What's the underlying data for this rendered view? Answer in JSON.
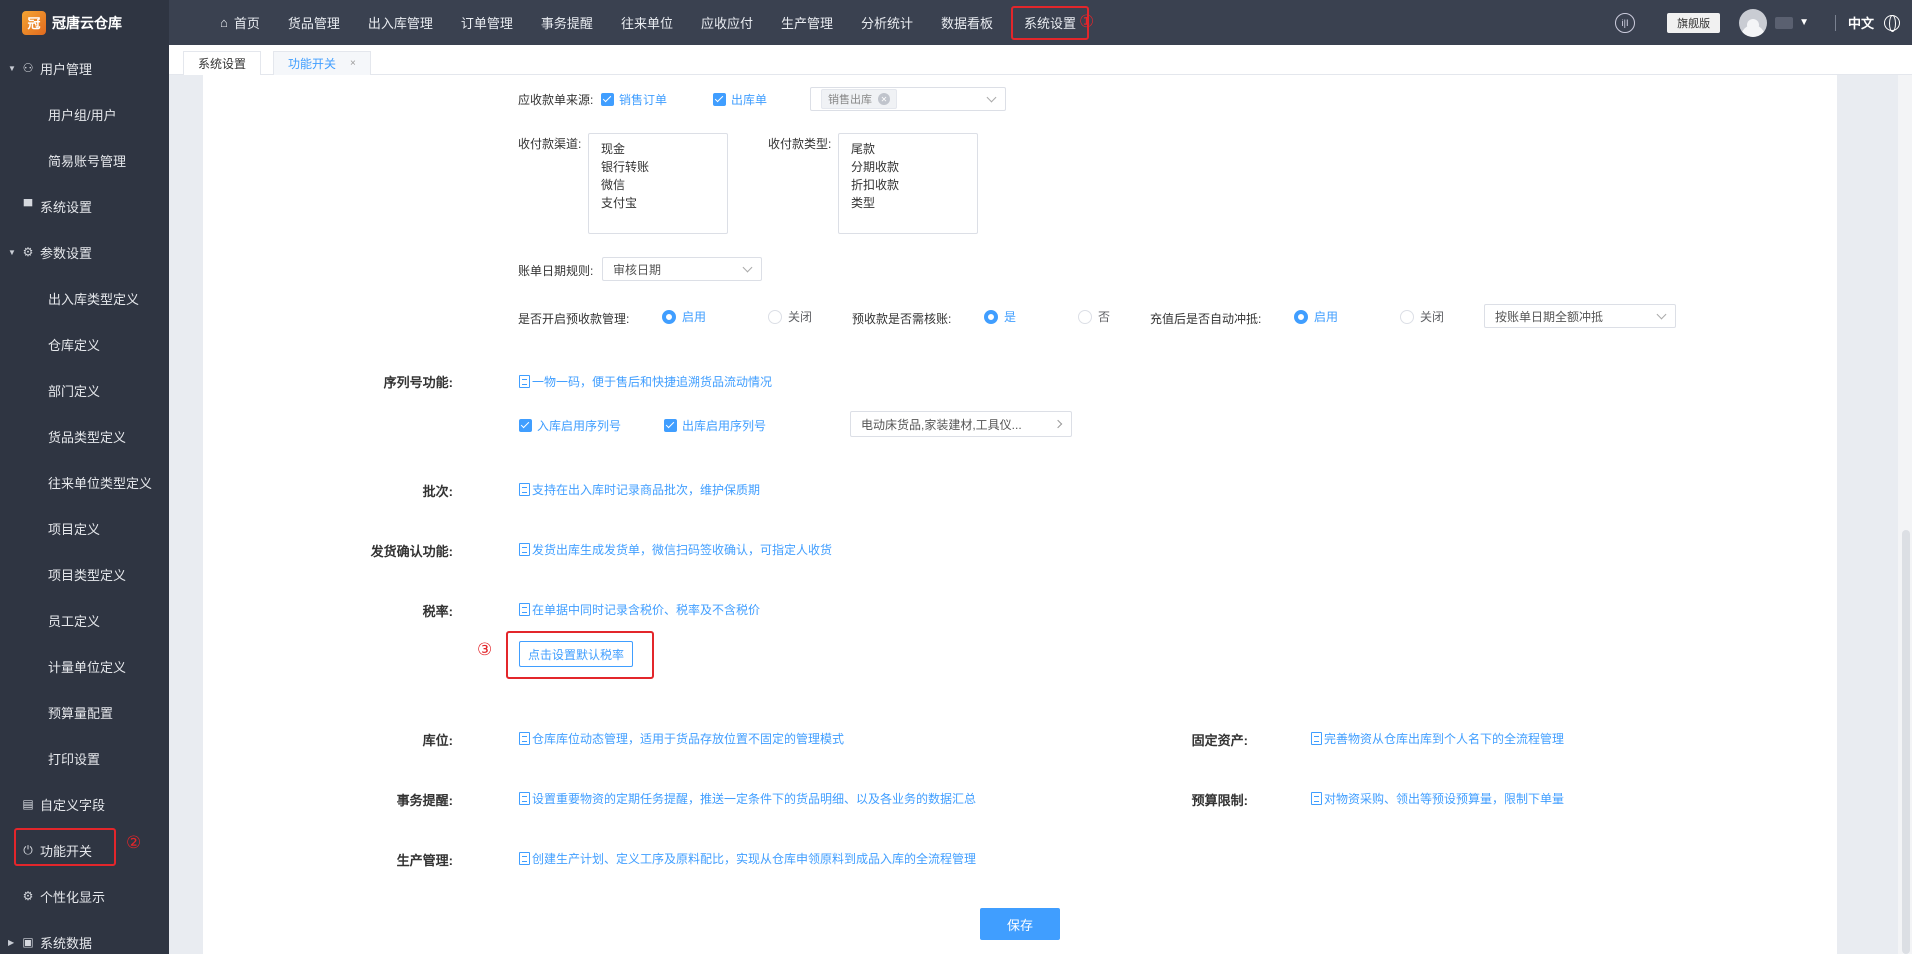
{
  "app": {
    "name": "冠唐云仓库",
    "logo_glyph": "冠"
  },
  "topnav": {
    "items": [
      "首页",
      "货品管理",
      "出入库管理",
      "订单管理",
      "事务提醒",
      "往来单位",
      "应收应付",
      "生产管理",
      "分析统计",
      "数据看板",
      "系统设置"
    ],
    "active": "系统设置",
    "annotation": "①"
  },
  "topright": {
    "help_glyph": "i|I",
    "edition": "旗舰版",
    "language": "中文"
  },
  "sidebar": {
    "items": [
      {
        "label": "用户管理",
        "icon": "user-icon"
      },
      {
        "label": "用户组/用户"
      },
      {
        "label": "简易账号管理"
      },
      {
        "label": "系统设置",
        "icon": "monitor-icon"
      },
      {
        "label": "参数设置",
        "icon": "gear-icon"
      },
      {
        "label": "出入库类型定义"
      },
      {
        "label": "仓库定义"
      },
      {
        "label": "部门定义"
      },
      {
        "label": "货品类型定义"
      },
      {
        "label": "往来单位类型定义"
      },
      {
        "label": "项目定义"
      },
      {
        "label": "项目类型定义"
      },
      {
        "label": "员工定义"
      },
      {
        "label": "计量单位定义"
      },
      {
        "label": "预算量配置"
      },
      {
        "label": "打印设置"
      },
      {
        "label": "自定义字段",
        "icon": "form-icon"
      },
      {
        "label": "功能开关",
        "icon": "power-icon"
      },
      {
        "label": "个性化显示",
        "icon": "gear-icon"
      },
      {
        "label": "系统数据",
        "icon": "data-icon"
      }
    ],
    "annotation": "②"
  },
  "tabs": [
    {
      "label": "系统设置"
    },
    {
      "label": "功能开关",
      "close": "×"
    }
  ],
  "form": {
    "receivable_source_label": "应收款单来源:",
    "source_sales_order": "销售订单",
    "source_outbound": "出库单",
    "source_tag": "销售出库",
    "channel_label": "收付款渠道:",
    "channels": [
      "现金",
      "银行转账",
      "微信",
      "支付宝"
    ],
    "paytype_label": "收付款类型:",
    "paytypes": [
      "尾款",
      "分期收款",
      "折扣收款",
      "类型"
    ],
    "bill_date_label": "账单日期规则:",
    "bill_date_value": "审核日期",
    "prepay_label": "是否开启预收款管理:",
    "prepay_on": "启用",
    "prepay_off": "关闭",
    "prepay_verify_label": "预收款是否需核账:",
    "yes": "是",
    "no": "否",
    "recharge_label": "充值后是否自动冲抵:",
    "recharge_on": "启用",
    "recharge_off": "关闭",
    "recharge_select": "按账单日期全额冲抵",
    "serial_label": "序列号功能:",
    "serial_desc": "一物一码，便于售后和快捷追溯货品流动情况",
    "serial_in": "入库启用序列号",
    "serial_out": "出库启用序列号",
    "serial_scope": "电动床货品,家装建材,工具仪...",
    "batch_label": "批次:",
    "batch_desc": "支持在出入库时记录商品批次，维护保质期",
    "ship_label": "发货确认功能:",
    "ship_desc": "发货出库生成发货单，微信扫码签收确认，可指定人收货",
    "tax_label": "税率:",
    "tax_desc": "在单据中同时记录含税价、税率及不含税价",
    "tax_button": "点击设置默认税率",
    "tax_annotation": "③",
    "location_label": "库位:",
    "location_desc": "仓库库位动态管理，适用于货品存放位置不固定的管理模式",
    "asset_label": "固定资产:",
    "asset_desc": "完善物资从仓库出库到个人名下的全流程管理",
    "reminder_label": "事务提醒:",
    "reminder_desc": "设置重要物资的定期任务提醒，推送一定条件下的货品明细、以及各业务的数据汇总",
    "budget_label": "预算限制:",
    "budget_desc": "对物资采购、领出等预设预算量，限制下单量",
    "production_label": "生产管理:",
    "production_desc": "创建生产计划、定义工序及原料配比，实现从仓库申领原料到成品入库的全流程管理",
    "save": "保存"
  },
  "colors": {
    "accent": "#409eff",
    "annotation": "#e3262b",
    "topbar": "#3a4150",
    "sidebar": "#2f3542"
  }
}
